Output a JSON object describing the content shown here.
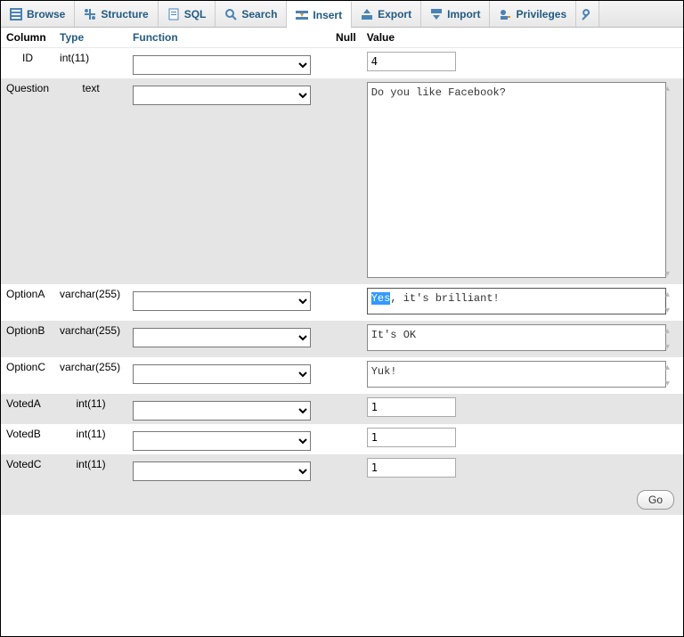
{
  "tabs": {
    "browse": "Browse",
    "structure": "Structure",
    "sql": "SQL",
    "search": "Search",
    "insert": "Insert",
    "export": "Export",
    "import": "Import",
    "privileges": "Privileges"
  },
  "headers": {
    "column": "Column",
    "type": "Type",
    "function": "Function",
    "null": "Null",
    "value": "Value"
  },
  "rows": {
    "id": {
      "name": "ID",
      "type": "int(11)",
      "value": "4"
    },
    "question": {
      "name": "Question",
      "type": "text",
      "value": "Do you like Facebook?"
    },
    "optiona": {
      "name": "OptionA",
      "type": "varchar(255)",
      "sel": "Yes",
      "rest": ", it's brilliant!"
    },
    "optionb": {
      "name": "OptionB",
      "type": "varchar(255)",
      "value": "It's OK"
    },
    "optionc": {
      "name": "OptionC",
      "type": "varchar(255)",
      "value": "Yuk!"
    },
    "voteda": {
      "name": "VotedA",
      "type": "int(11)",
      "value": "1"
    },
    "votedb": {
      "name": "VotedB",
      "type": "int(11)",
      "value": "1"
    },
    "votedc": {
      "name": "VotedC",
      "type": "int(11)",
      "value": "1"
    }
  },
  "footer": {
    "go": "Go"
  }
}
